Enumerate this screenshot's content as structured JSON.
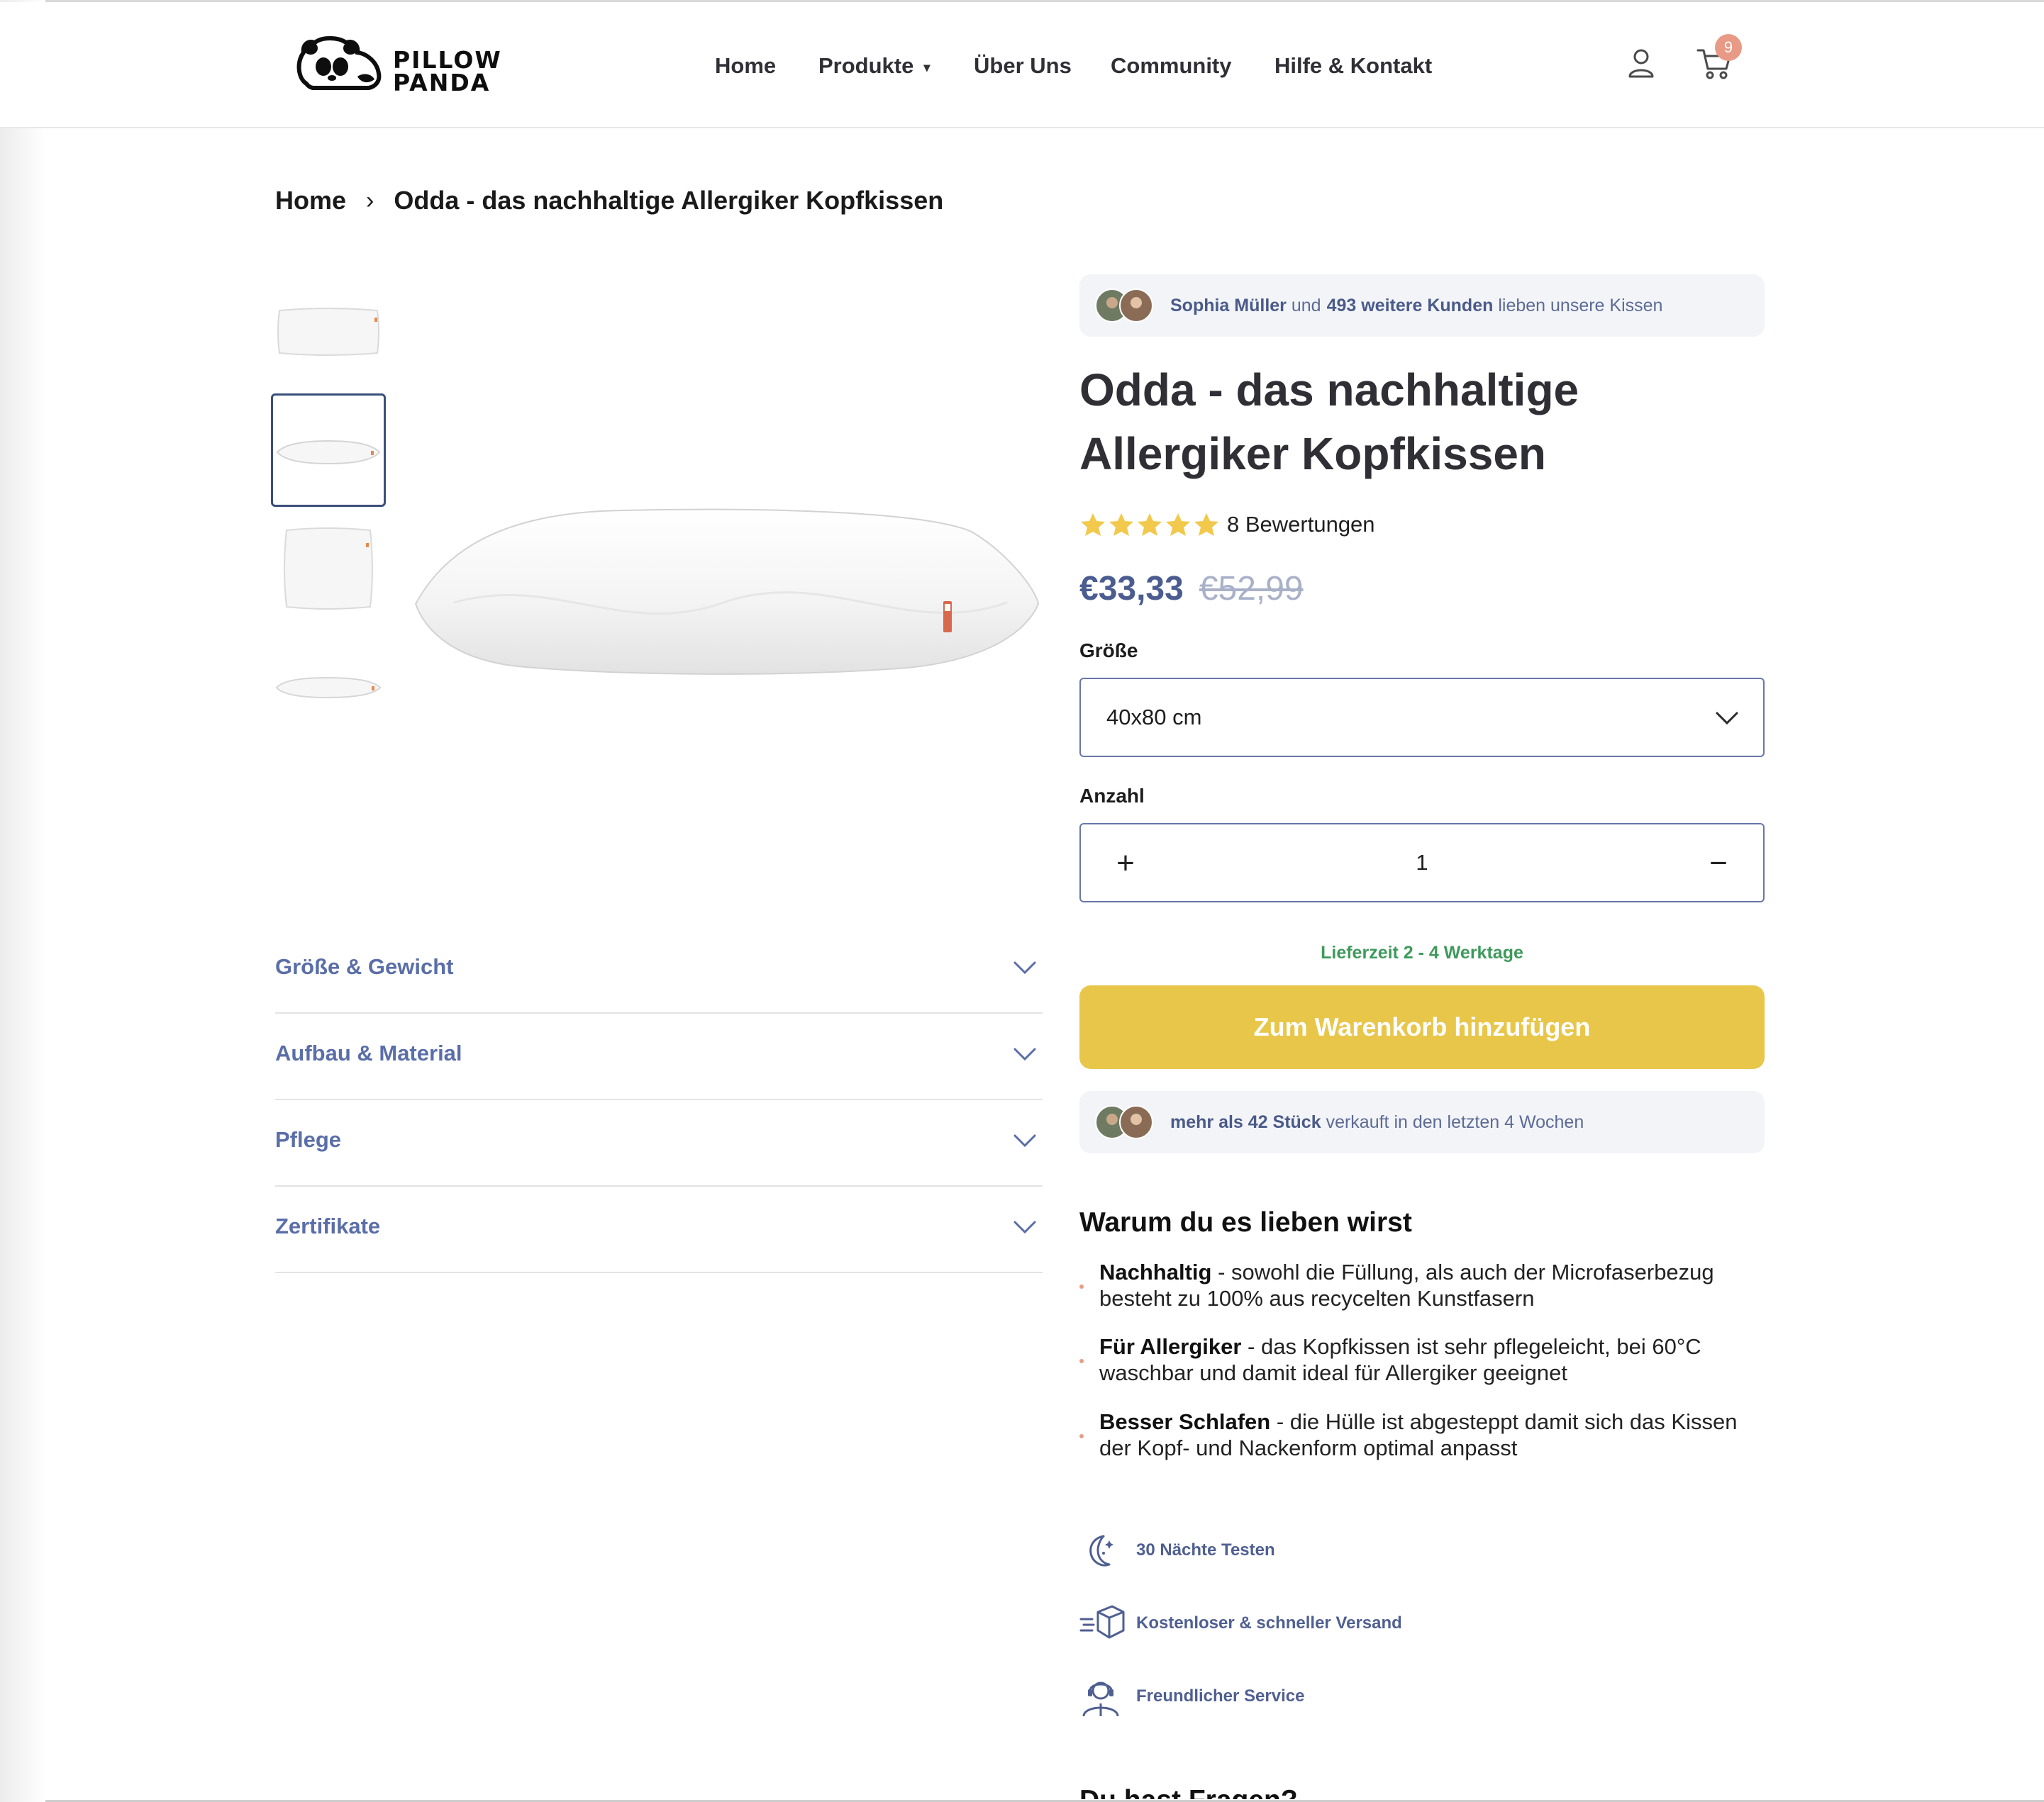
{
  "brand": {
    "logo_line1": "PILLOW",
    "logo_line2": "PANDA"
  },
  "nav": {
    "items": [
      {
        "label": "Home"
      },
      {
        "label": "Produkte",
        "caret": "˅"
      },
      {
        "label": "Über Uns"
      },
      {
        "label": "Community"
      },
      {
        "label": "Hilfe & Kontakt"
      }
    ],
    "cart_count": "9",
    "icons": [
      "user-icon",
      "cart-icon"
    ]
  },
  "breadcrumb": {
    "home": "Home",
    "separator": "›",
    "current": "Odda - das nachhaltige Allergiker Kopfkissen"
  },
  "accordion": [
    {
      "label": "Größe & Gewicht"
    },
    {
      "label": "Aufbau & Material"
    },
    {
      "label": "Pflege"
    },
    {
      "label": "Zertifikate"
    }
  ],
  "social_proof_top": {
    "name": "Sophia Müller",
    "connector": "und",
    "count_text": "493 weitere Kunden",
    "suffix": "lieben unsere Kissen"
  },
  "product": {
    "title_line1": "Odda - das nachhaltige",
    "title_line2": "Allergiker Kopfkissen",
    "rating_stars": 5,
    "reviews": "8 Bewertungen",
    "price_now": "€33,33",
    "price_was": "€52,99",
    "size_label": "Größe",
    "size_value": "40x80 cm",
    "qty_label": "Anzahl",
    "qty_value": "1",
    "plus": "+",
    "minus": "−",
    "delivery": "Lieferzeit 2 - 4 Werktage",
    "add_to_cart": "Zum Warenkorb hinzufügen"
  },
  "social_proof_bottom": {
    "strong": "mehr als 42 Stück",
    "rest": "verkauft in den letzten 4 Wochen"
  },
  "why": {
    "title": "Warum du es lieben wirst",
    "items": [
      {
        "strong": "Nachhaltig",
        "text": " - sowohl die Füllung, als auch der Microfaserbezug besteht zu 100% aus recycelten Kunstfasern"
      },
      {
        "strong": "Für Allergiker",
        "text": " - das Kopfkissen ist sehr pflegeleicht, bei 60°C waschbar und damit ideal für Allergiker geeignet"
      },
      {
        "strong": "Besser Schlafen",
        "text": " - die Hülle ist abgesteppt damit sich das Kissen der Kopf- und Nackenform optimal anpasst"
      }
    ]
  },
  "features": [
    {
      "label": "30 Nächte Testen",
      "icon": "moon-stars-icon"
    },
    {
      "label": "Kostenloser & schneller Versand",
      "icon": "shipping-box-icon"
    },
    {
      "label": "Freundlicher Service",
      "icon": "support-agent-icon"
    }
  ],
  "faq_peek": "Du hast Fragen?",
  "colors": {
    "accent_blue": "#4b5c91",
    "button_yellow": "#e8c64a",
    "delivery_green": "#3e9a5c",
    "badge": "#e89a86"
  }
}
